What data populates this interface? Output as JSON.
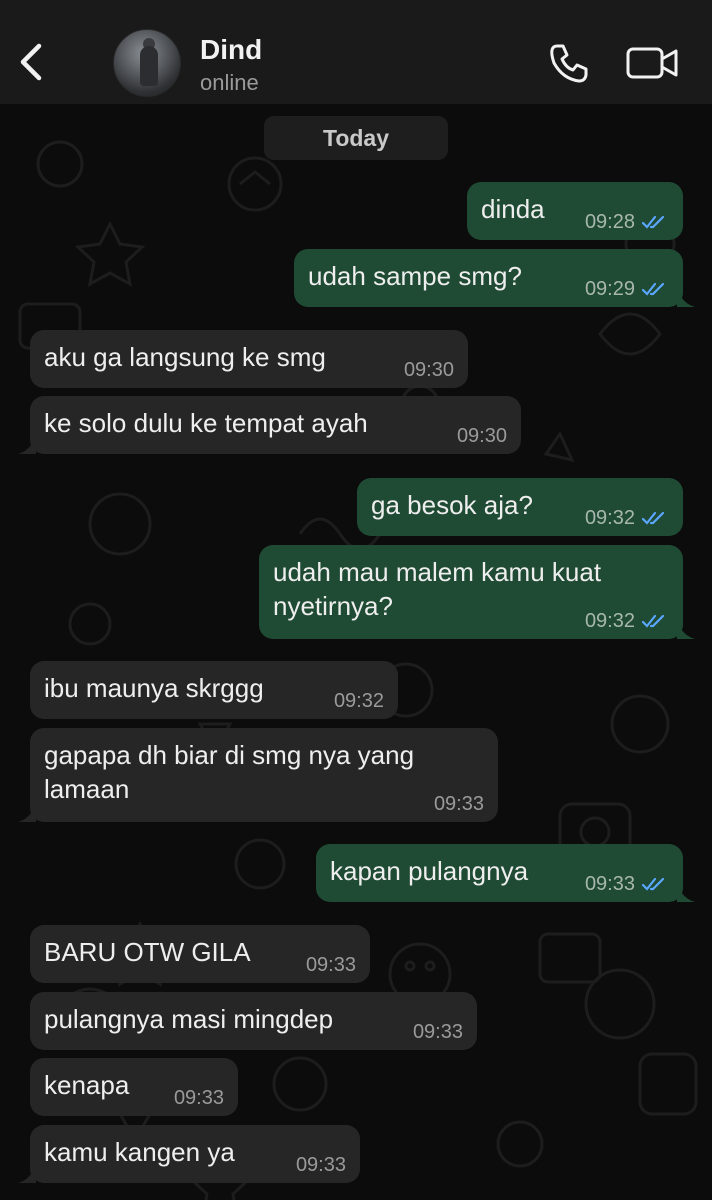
{
  "header": {
    "contact_name": "Dind",
    "status": "online",
    "back_icon": "chevron-left-icon",
    "call_icon": "phone-icon",
    "video_icon": "video-camera-icon"
  },
  "date_separator": "Today",
  "colors": {
    "header_bg": "#1a1a1a",
    "outgoing_bubble": "#1f4a33",
    "incoming_bubble": "#262626",
    "read_tick": "#5aa7ff",
    "background": "#0c0c0c"
  },
  "messages": [
    {
      "direction": "out",
      "text": "dinda",
      "time": "09:28",
      "read": true
    },
    {
      "direction": "out",
      "text": "udah sampe smg?",
      "time": "09:29",
      "read": true
    },
    {
      "direction": "in",
      "text": "aku ga langsung ke smg",
      "time": "09:30"
    },
    {
      "direction": "in",
      "text": "ke solo dulu ke tempat ayah",
      "time": "09:30"
    },
    {
      "direction": "out",
      "text": "ga besok aja?",
      "time": "09:32",
      "read": true
    },
    {
      "direction": "out",
      "text": "udah mau malem kamu kuat\nnyetirnya?",
      "time": "09:32",
      "read": true
    },
    {
      "direction": "in",
      "text": "ibu maunya skrggg",
      "time": "09:32"
    },
    {
      "direction": "in",
      "text": "gapapa dh biar di smg nya yang\nlamaan",
      "time": "09:33"
    },
    {
      "direction": "out",
      "text": "kapan pulangnya",
      "time": "09:33",
      "read": true
    },
    {
      "direction": "in",
      "text": "BARU OTW GILA",
      "time": "09:33"
    },
    {
      "direction": "in",
      "text": "pulangnya masi mingdep",
      "time": "09:33"
    },
    {
      "direction": "in",
      "text": "kenapa",
      "time": "09:33"
    },
    {
      "direction": "in",
      "text": "kamu kangen ya",
      "time": "09:33"
    }
  ]
}
